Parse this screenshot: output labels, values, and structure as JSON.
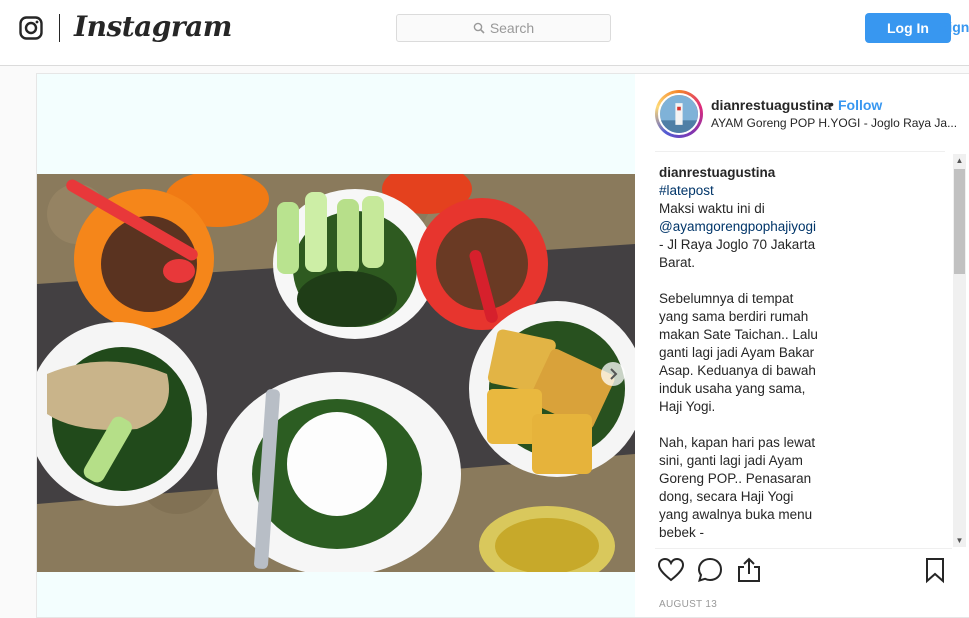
{
  "header": {
    "wordmark": "Instagram",
    "search_placeholder": "Search",
    "login_label": "Log In",
    "signup_label": "Sign"
  },
  "post": {
    "author": "dianrestuagustina",
    "separator": "•",
    "follow_label": "Follow",
    "location": "AYAM Goreng POP H.YOGI - Joglo Raya Ja...",
    "caption": {
      "author": "dianrestuagustina",
      "hashtag": "#latepost",
      "line1": "Maksi waktu ini di",
      "mention": "@ayamgorengpophajiyogi",
      "line2": " - Jl Raya Joglo 70 Jakarta Barat.",
      "para2": "Sebelumnya di tempat yang sama berdiri rumah makan Sate Taichan.. Lalu ganti lagi jadi Ayam Bakar Asap. Keduanya di bawah induk usaha yang sama, Haji Yogi.",
      "para3": "Nah, kapan hari pas lewat sini, ganti lagi jadi Ayam Goreng POP.. Penasaran dong, secara Haji Yogi yang awalnya buka menu bebek -"
    },
    "date": "AUGUST 13"
  },
  "icons": {
    "logo": "instagram-glyph-icon",
    "search": "search-icon",
    "next": "chevron-right-icon",
    "like": "heart-icon",
    "comment": "comment-icon",
    "share": "share-icon",
    "save": "bookmark-icon"
  },
  "colors": {
    "accent": "#3897f0",
    "link": "#003569",
    "photo_background": "#f3fefe"
  }
}
